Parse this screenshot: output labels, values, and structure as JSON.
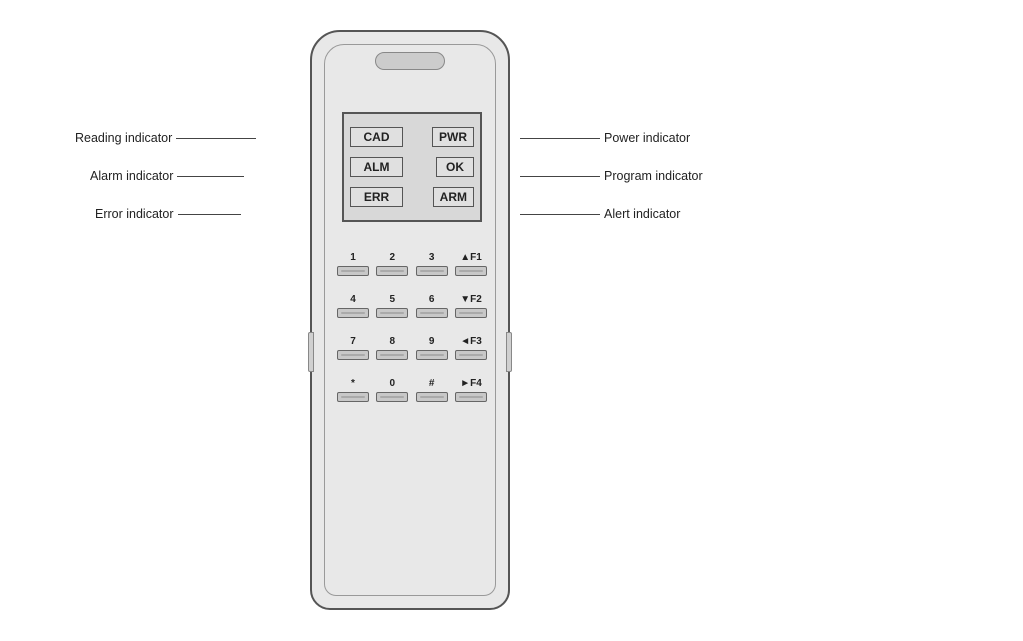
{
  "labels": {
    "reading_indicator": "Reading indicator",
    "alarm_indicator": "Alarm indicator",
    "error_indicator": "Error indicator",
    "power_indicator": "Power indicator",
    "program_indicator": "Program indicator",
    "alert_indicator": "Alert indicator"
  },
  "indicators": {
    "left": [
      "CAD",
      "ALM",
      "ERR"
    ],
    "right": [
      "PWR",
      "OK",
      "ARM"
    ]
  },
  "keypad": {
    "rows": [
      [
        {
          "label": "1",
          "key": "1"
        },
        {
          "label": "2",
          "key": "2"
        },
        {
          "label": "3",
          "key": "3"
        },
        {
          "label": "▲F1",
          "key": "F1"
        }
      ],
      [
        {
          "label": "4",
          "key": "4"
        },
        {
          "label": "5",
          "key": "5"
        },
        {
          "label": "6",
          "key": "6"
        },
        {
          "label": "▼F2",
          "key": "F2"
        }
      ],
      [
        {
          "label": "7",
          "key": "7"
        },
        {
          "label": "8",
          "key": "8"
        },
        {
          "label": "9",
          "key": "9"
        },
        {
          "label": "◄F3",
          "key": "F3"
        }
      ],
      [
        {
          "label": "*",
          "key": "*"
        },
        {
          "label": "0",
          "key": "0"
        },
        {
          "label": "#",
          "key": "#"
        },
        {
          "label": "►F4",
          "key": "F4"
        }
      ]
    ]
  }
}
